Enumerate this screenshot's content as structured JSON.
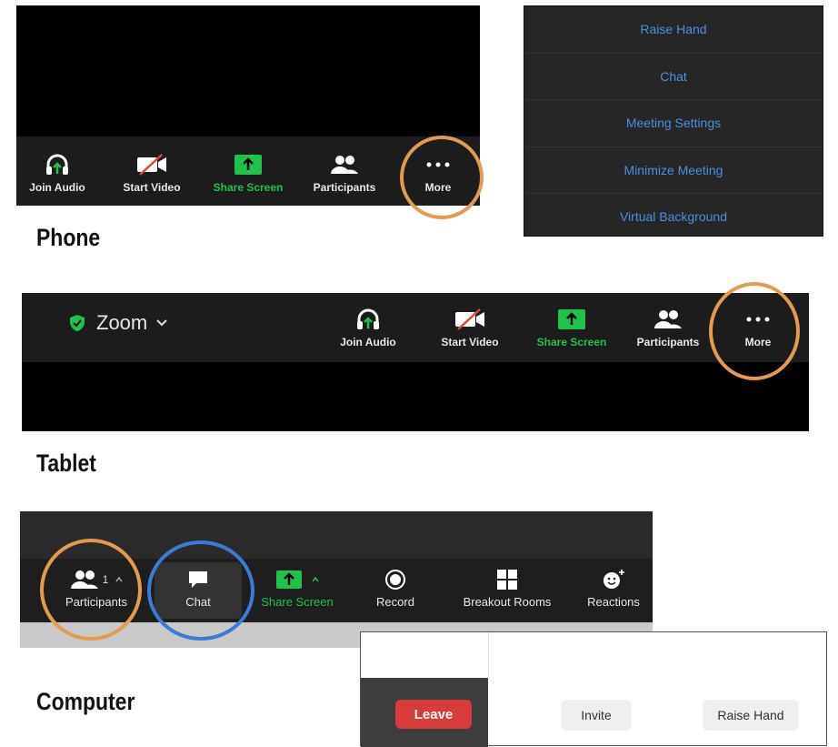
{
  "phone": {
    "heading": "Phone",
    "toolbar": [
      {
        "label": "Join Audio",
        "icon": "headphones-icon"
      },
      {
        "label": "Start Video",
        "icon": "video-off-icon"
      },
      {
        "label": "Share Screen",
        "icon": "share-screen-icon"
      },
      {
        "label": "Participants",
        "icon": "participants-icon"
      },
      {
        "label": "More",
        "icon": "more-dots-icon"
      }
    ],
    "more_menu": [
      "Raise Hand",
      "Chat",
      "Meeting Settings",
      "Minimize Meeting",
      "Virtual Background"
    ]
  },
  "tablet": {
    "heading": "Tablet",
    "app_title": "Zoom",
    "toolbar": [
      {
        "label": "Join Audio",
        "icon": "headphones-icon"
      },
      {
        "label": "Start Video",
        "icon": "video-off-icon"
      },
      {
        "label": "Share Screen",
        "icon": "share-screen-icon"
      },
      {
        "label": "Participants",
        "icon": "participants-icon"
      },
      {
        "label": "More",
        "icon": "more-dots-icon"
      }
    ]
  },
  "computer": {
    "heading": "Computer",
    "participant_count": "1",
    "toolbar": [
      {
        "label": "Participants",
        "icon": "participants-icon"
      },
      {
        "label": "Chat",
        "icon": "chat-bubble-icon"
      },
      {
        "label": "Share Screen",
        "icon": "share-screen-icon"
      },
      {
        "label": "Record",
        "icon": "record-icon"
      },
      {
        "label": "Breakout Rooms",
        "icon": "breakout-rooms-icon"
      },
      {
        "label": "Reactions",
        "icon": "reactions-icon"
      }
    ],
    "leave_label": "Leave",
    "invite_label": "Invite",
    "raise_hand_label": "Raise Hand"
  },
  "colors": {
    "accent_green": "#20c34a",
    "menu_blue": "#4a90e2",
    "leave_red": "#d93a3a",
    "highlight_orange": "#e39b4f",
    "highlight_blue": "#3a7bd5"
  }
}
